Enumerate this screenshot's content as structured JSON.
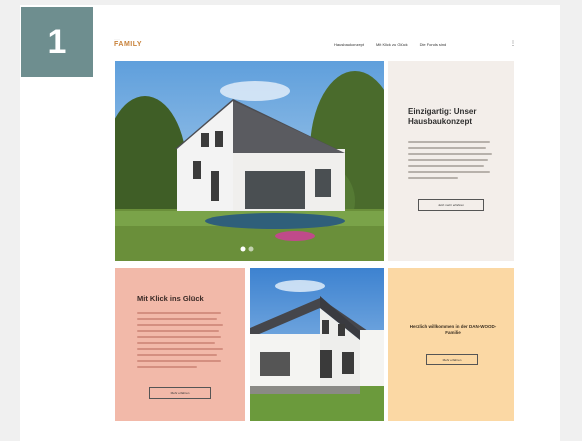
{
  "step": {
    "number": "1"
  },
  "header": {
    "logo_sub": "……",
    "logo_main": "FAMILY",
    "nav": [
      "Hausbaukonzept",
      "Mit Klick zu Glück",
      "Die Fonds sind"
    ],
    "more_icon": "vertical-dots-icon"
  },
  "hero": {
    "title": "Einzigartig: Unser Hausbaukonzept",
    "button": "Jetzt mehr erfahren"
  },
  "tile_pink": {
    "title": "Mit Klick ins Glück",
    "button": "Mehr erfahren"
  },
  "tile_yellow": {
    "title": "Herzlich willkommen in der DAN-WOOD-Familie",
    "button": "Mehr erfahren"
  },
  "colors": {
    "badge": "#6e8e8f",
    "hero_panel": "#f3eeea",
    "pink": "#f2b9a9",
    "yellow": "#fbd8a4"
  }
}
